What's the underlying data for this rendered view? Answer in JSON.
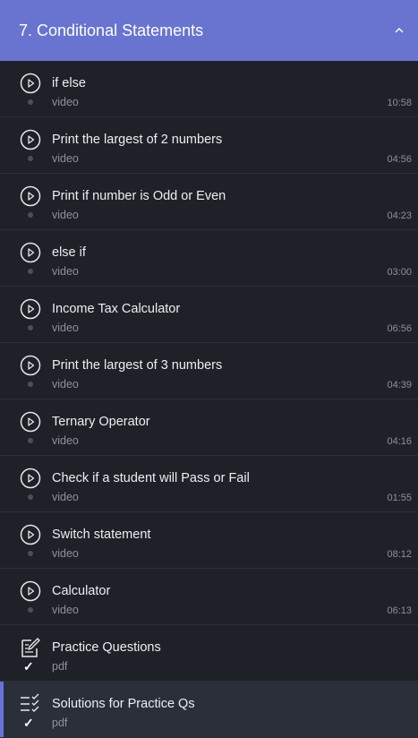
{
  "section": {
    "title": "7. Conditional Statements"
  },
  "items": [
    {
      "title": "if else",
      "type": "video",
      "duration": "10:58",
      "icon": "play-circle-icon"
    },
    {
      "title": "Print the largest of 2 numbers",
      "type": "video",
      "duration": "04:56",
      "icon": "play-circle-icon"
    },
    {
      "title": "Print if number is Odd or Even",
      "type": "video",
      "duration": "04:23",
      "icon": "play-circle-icon"
    },
    {
      "title": "else if",
      "type": "video",
      "duration": "03:00",
      "icon": "play-circle-icon"
    },
    {
      "title": "Income Tax Calculator",
      "type": "video",
      "duration": "06:56",
      "icon": "play-circle-icon"
    },
    {
      "title": "Print the largest of 3 numbers",
      "type": "video",
      "duration": "04:39",
      "icon": "play-circle-icon"
    },
    {
      "title": "Ternary Operator",
      "type": "video",
      "duration": "04:16",
      "icon": "play-circle-icon"
    },
    {
      "title": "Check if a student will Pass or Fail",
      "type": "video",
      "duration": "01:55",
      "icon": "play-circle-icon"
    },
    {
      "title": "Switch statement",
      "type": "video",
      "duration": "08:12",
      "icon": "play-circle-icon"
    },
    {
      "title": "Calculator",
      "type": "video",
      "duration": "06:13",
      "icon": "play-circle-icon"
    },
    {
      "title": "Practice Questions",
      "type": "pdf",
      "duration": "",
      "icon": "edit-document-icon",
      "completed": true
    },
    {
      "title": "Solutions for Practice Qs",
      "type": "pdf",
      "duration": "",
      "icon": "checklist-icon",
      "completed": true,
      "active": true
    }
  ],
  "colors": {
    "accent": "#6874cf",
    "background": "#1f2128",
    "active_row": "#2b2f3a"
  }
}
